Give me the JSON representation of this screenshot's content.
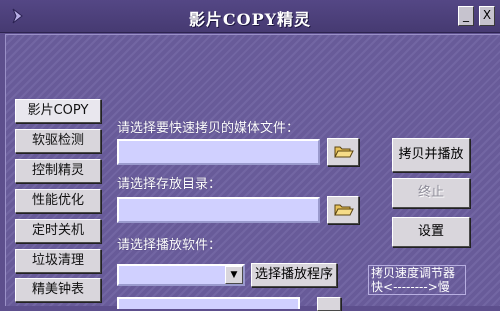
{
  "window": {
    "title": "影片COPY精灵",
    "minimize_glyph": "_",
    "close_glyph": "X"
  },
  "nav": {
    "items": [
      {
        "label": "影片COPY"
      },
      {
        "label": "软驱检测"
      },
      {
        "label": "控制精灵"
      },
      {
        "label": "性能优化"
      },
      {
        "label": "定时关机"
      },
      {
        "label": "垃圾清理"
      },
      {
        "label": "精美钟表"
      }
    ]
  },
  "main": {
    "media_file_label": "请选择要快速拷贝的媒体文件：",
    "media_file_value": "",
    "save_dir_label": "请选择存放目录：",
    "save_dir_value": "",
    "player_label": "请选择播放软件：",
    "player_selected": "",
    "choose_player_button": "选择播放程序"
  },
  "actions": {
    "copy_play_button": "拷贝并播放",
    "stop_button": "终止",
    "settings_button": "设置"
  },
  "speed": {
    "title": "拷贝速度调节器",
    "fast": "快",
    "arrows": "<-------->",
    "slow": "慢"
  },
  "colors": {
    "titlebar": "#4d4080",
    "panel": "#6b5e9e",
    "field": "#d0d0ff",
    "button": "#d9d6dc"
  }
}
